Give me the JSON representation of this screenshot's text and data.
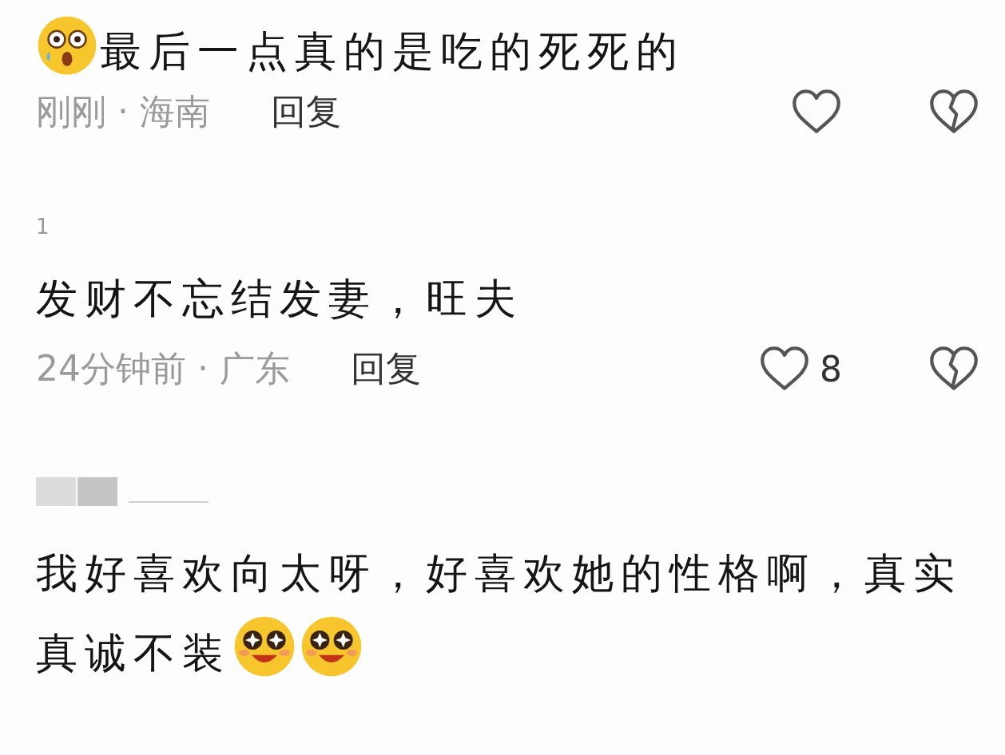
{
  "comments": [
    {
      "emoji_before": [
        {
          "kind": "shocked"
        }
      ],
      "text": "最后一点真的是吃的死死的",
      "time_location": "刚刚 · 海南",
      "reply": "回复"
    },
    {
      "username": "1",
      "text": "发财不忘结发妻，旺夫",
      "time_location": "24分钟前 · 广东",
      "reply": "回复",
      "like_count": "8"
    },
    {
      "username_hidden": true,
      "text": "我好喜欢向太呀，好喜欢她的性格啊，真实真诚不装",
      "emoji_after": [
        {
          "kind": "starry"
        },
        {
          "kind": "starry"
        }
      ]
    }
  ]
}
